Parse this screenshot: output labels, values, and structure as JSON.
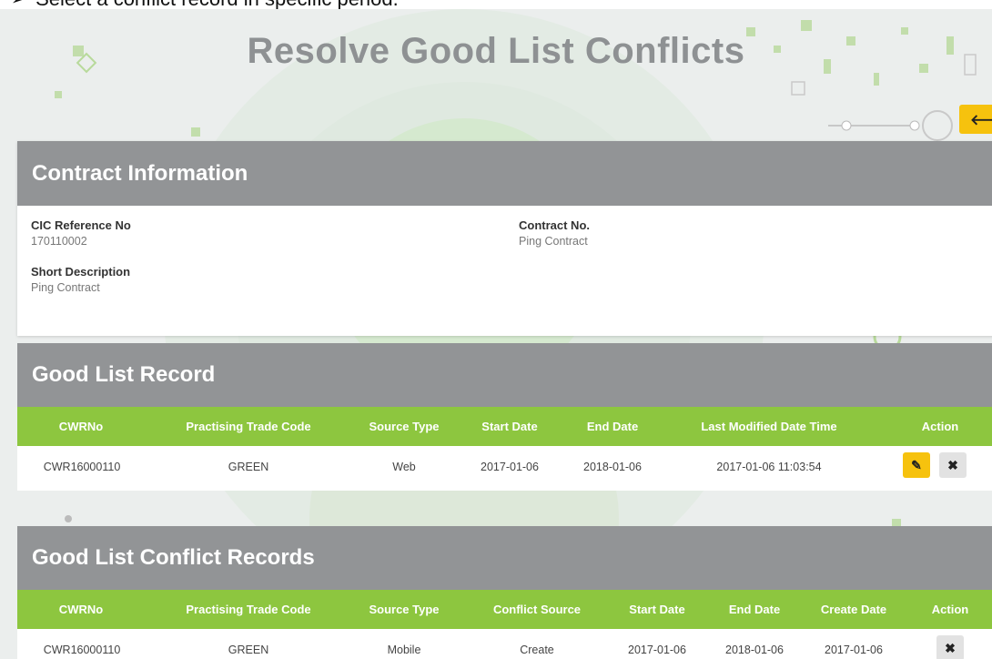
{
  "instruction": {
    "text": "Select a conflict record in specific period."
  },
  "page": {
    "title": "Resolve Good List Conflicts"
  },
  "contract_info": {
    "header": "Contract Information",
    "cic_ref_label": "CIC Reference No",
    "cic_ref_value": "170110002",
    "contract_no_label": "Contract No.",
    "contract_no_value": "Ping Contract",
    "short_desc_label": "Short Description",
    "short_desc_value": "Ping Contract"
  },
  "good_list_record": {
    "header": "Good List Record",
    "columns": [
      "CWRNo",
      "Practising Trade Code",
      "Source Type",
      "Start Date",
      "End Date",
      "Last Modified Date Time",
      "Action"
    ],
    "rows": [
      {
        "cwrno": "CWR16000110",
        "trade_code": "GREEN",
        "source_type": "Web",
        "start_date": "2017-01-06",
        "end_date": "2018-01-06",
        "last_modified": "2017-01-06 11:03:54"
      }
    ]
  },
  "conflict_records": {
    "header": "Good List Conflict Records",
    "columns": [
      "CWRNo",
      "Practising Trade Code",
      "Source Type",
      "Conflict Source",
      "Start Date",
      "End Date",
      "Create Date",
      "Action"
    ],
    "rows": [
      {
        "cwrno": "CWR16000110",
        "trade_code": "GREEN",
        "source_type": "Mobile",
        "conflict_source": "Create",
        "start_date": "2017-01-06",
        "end_date": "2018-01-06",
        "create_date": "2017-01-06"
      }
    ]
  },
  "icons": {
    "back": "arrow-left-icon",
    "edit": "pencil-icon",
    "delete": "close-icon"
  },
  "colors": {
    "header_gray": "#929496",
    "table_green": "#8dc63f",
    "accent_yellow": "#f6c20e"
  }
}
